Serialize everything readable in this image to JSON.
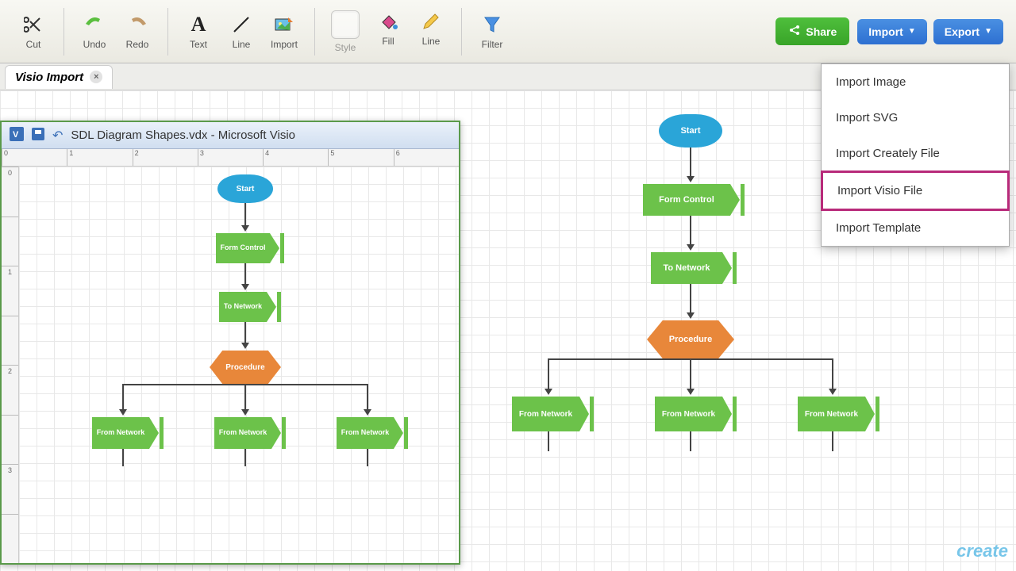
{
  "toolbar": {
    "cut": "Cut",
    "undo": "Undo",
    "redo": "Redo",
    "text": "Text",
    "line": "Line",
    "import": "Import",
    "style": "Style",
    "fill": "Fill",
    "line2": "Line",
    "filter": "Filter",
    "share": "Share",
    "import_btn": "Import",
    "export_btn": "Export"
  },
  "tab": {
    "title": "Visio Import"
  },
  "dropdown": {
    "items": [
      "Import Image",
      "Import SVG",
      "Import Creately File",
      "Import Visio File",
      "Import Template"
    ],
    "highlighted_index": 3
  },
  "visio": {
    "title": "SDL Diagram Shapes.vdx  -  Microsoft Visio",
    "h_ticks": [
      "0",
      "1",
      "2",
      "3",
      "4",
      "5",
      "6"
    ],
    "v_ticks": [
      "0",
      "",
      "1",
      "",
      "2",
      "",
      "3",
      ""
    ]
  },
  "flow": {
    "start": "Start",
    "form_control": "Form Control",
    "to_network": "To Network",
    "procedure": "Procedure",
    "from_network": "From Network"
  },
  "watermark": "create"
}
